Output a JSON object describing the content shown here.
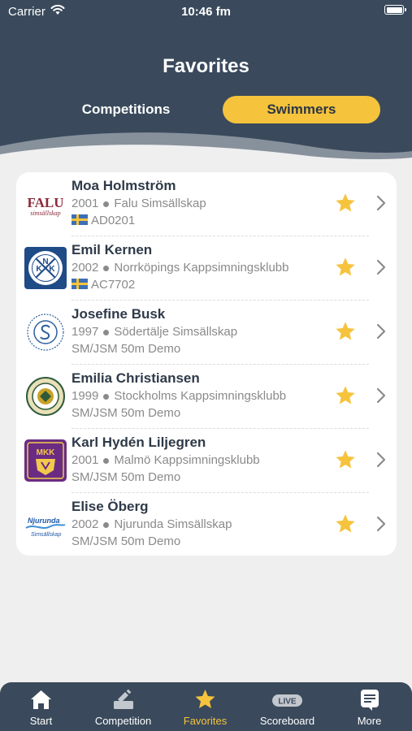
{
  "status_bar": {
    "carrier": "Carrier",
    "time": "10:46 fm"
  },
  "header": {
    "title": "Favorites"
  },
  "segments": {
    "left": "Competitions",
    "right": "Swimmers",
    "selected": "Swimmers"
  },
  "colors": {
    "header_bg": "#3a4a5c",
    "accent": "#f6c33c",
    "card_bg": "#ffffff",
    "page_bg": "#efefef"
  },
  "swimmers": [
    {
      "name": "Moa Holmström",
      "year": "2001",
      "club": "Falu Simsällskap",
      "extra": "AD0201",
      "flag": "sweden-flag",
      "logo": "falu-logo",
      "favorite": true
    },
    {
      "name": "Emil Kernen",
      "year": "2002",
      "club": "Norrköpings Kappsimningsklubb",
      "extra": "AC7702",
      "flag": "sweden-flag",
      "logo": "nkk-logo",
      "favorite": true
    },
    {
      "name": "Josefine Busk",
      "year": "1997",
      "club": "Södertälje Simsällskap",
      "extra": "SM/JSM 50m Demo",
      "flag": null,
      "logo": "sodertalje-logo",
      "favorite": true
    },
    {
      "name": "Emilia Christiansen",
      "year": "1999",
      "club": "Stockholms Kappsimningsklubb",
      "extra": "SM/JSM 50m Demo",
      "flag": null,
      "logo": "sk-logo",
      "favorite": true
    },
    {
      "name": "Karl Hydén Liljegren",
      "year": "2001",
      "club": "Malmö Kappsimningsklubb",
      "extra": "SM/JSM 50m Demo",
      "flag": null,
      "logo": "mkk-logo",
      "favorite": true
    },
    {
      "name": "Elise Öberg",
      "year": "2002",
      "club": "Njurunda Simsällskap",
      "extra": "SM/JSM 50m Demo",
      "flag": null,
      "logo": "njurunda-logo",
      "favorite": true
    }
  ],
  "logos": {
    "falu": {
      "top": "FALU",
      "bottom": "simsällskap"
    },
    "nkk": {
      "n": "N",
      "k1": "K",
      "k2": "K"
    },
    "mkk": {
      "text": "MKK"
    },
    "njurunda": {
      "top": "Njurunda",
      "bottom": "Simsällskap"
    }
  },
  "tabbar": {
    "active": "Favorites",
    "tabs": [
      {
        "label": "Start",
        "icon": "home-icon"
      },
      {
        "label": "Competition",
        "icon": "podium-icon"
      },
      {
        "label": "Favorites",
        "icon": "star-icon"
      },
      {
        "label": "Scoreboard",
        "icon": "live-icon",
        "badge": "LIVE"
      },
      {
        "label": "More",
        "icon": "more-icon"
      }
    ]
  }
}
